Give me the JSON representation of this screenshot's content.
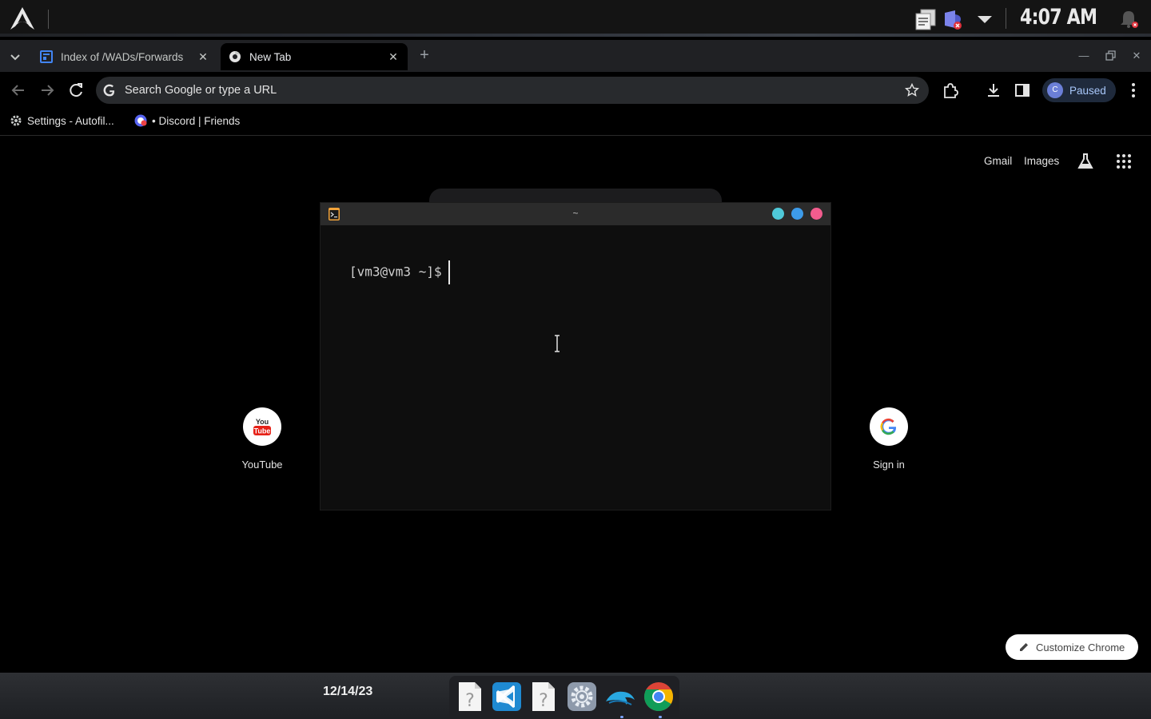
{
  "system_panel": {
    "clock": "4:07 AM",
    "tray_icons": [
      "clipboard-icon",
      "teams-icon",
      "dropdown-arrow-icon",
      "notification-bell-icon"
    ]
  },
  "browser": {
    "tabs": [
      {
        "title": "Index of /WADs/Forwards",
        "active": false
      },
      {
        "title": "New Tab",
        "active": true
      }
    ],
    "omnibox_placeholder": "Search Google or type a URL",
    "profile": {
      "initial": "C",
      "status": "Paused"
    },
    "bookmarks": [
      {
        "label": "Settings - Autofil..."
      },
      {
        "label": "• Discord | Friends"
      }
    ]
  },
  "ntp": {
    "links": {
      "gmail": "Gmail",
      "images": "Images"
    },
    "shortcuts": [
      {
        "label": "YouTube"
      },
      {
        "label": "Sign in"
      }
    ],
    "customize_label": "Customize Chrome"
  },
  "terminal": {
    "title": "~",
    "prompt": "[vm3@vm3 ~]$"
  },
  "dock": {
    "date": "12/14/23",
    "apps": [
      "unknown-file-icon",
      "vscode-icon",
      "unknown-file-icon",
      "settings-gear-icon",
      "dolphin-emulator-icon",
      "chrome-icon"
    ]
  },
  "colors": {
    "terminal_dot_1": "#4fc9d9",
    "terminal_dot_2": "#3d9be9",
    "terminal_dot_3": "#f25c8e",
    "profile_chip": "#1f2a3c",
    "accent": "#a8c7fa"
  }
}
